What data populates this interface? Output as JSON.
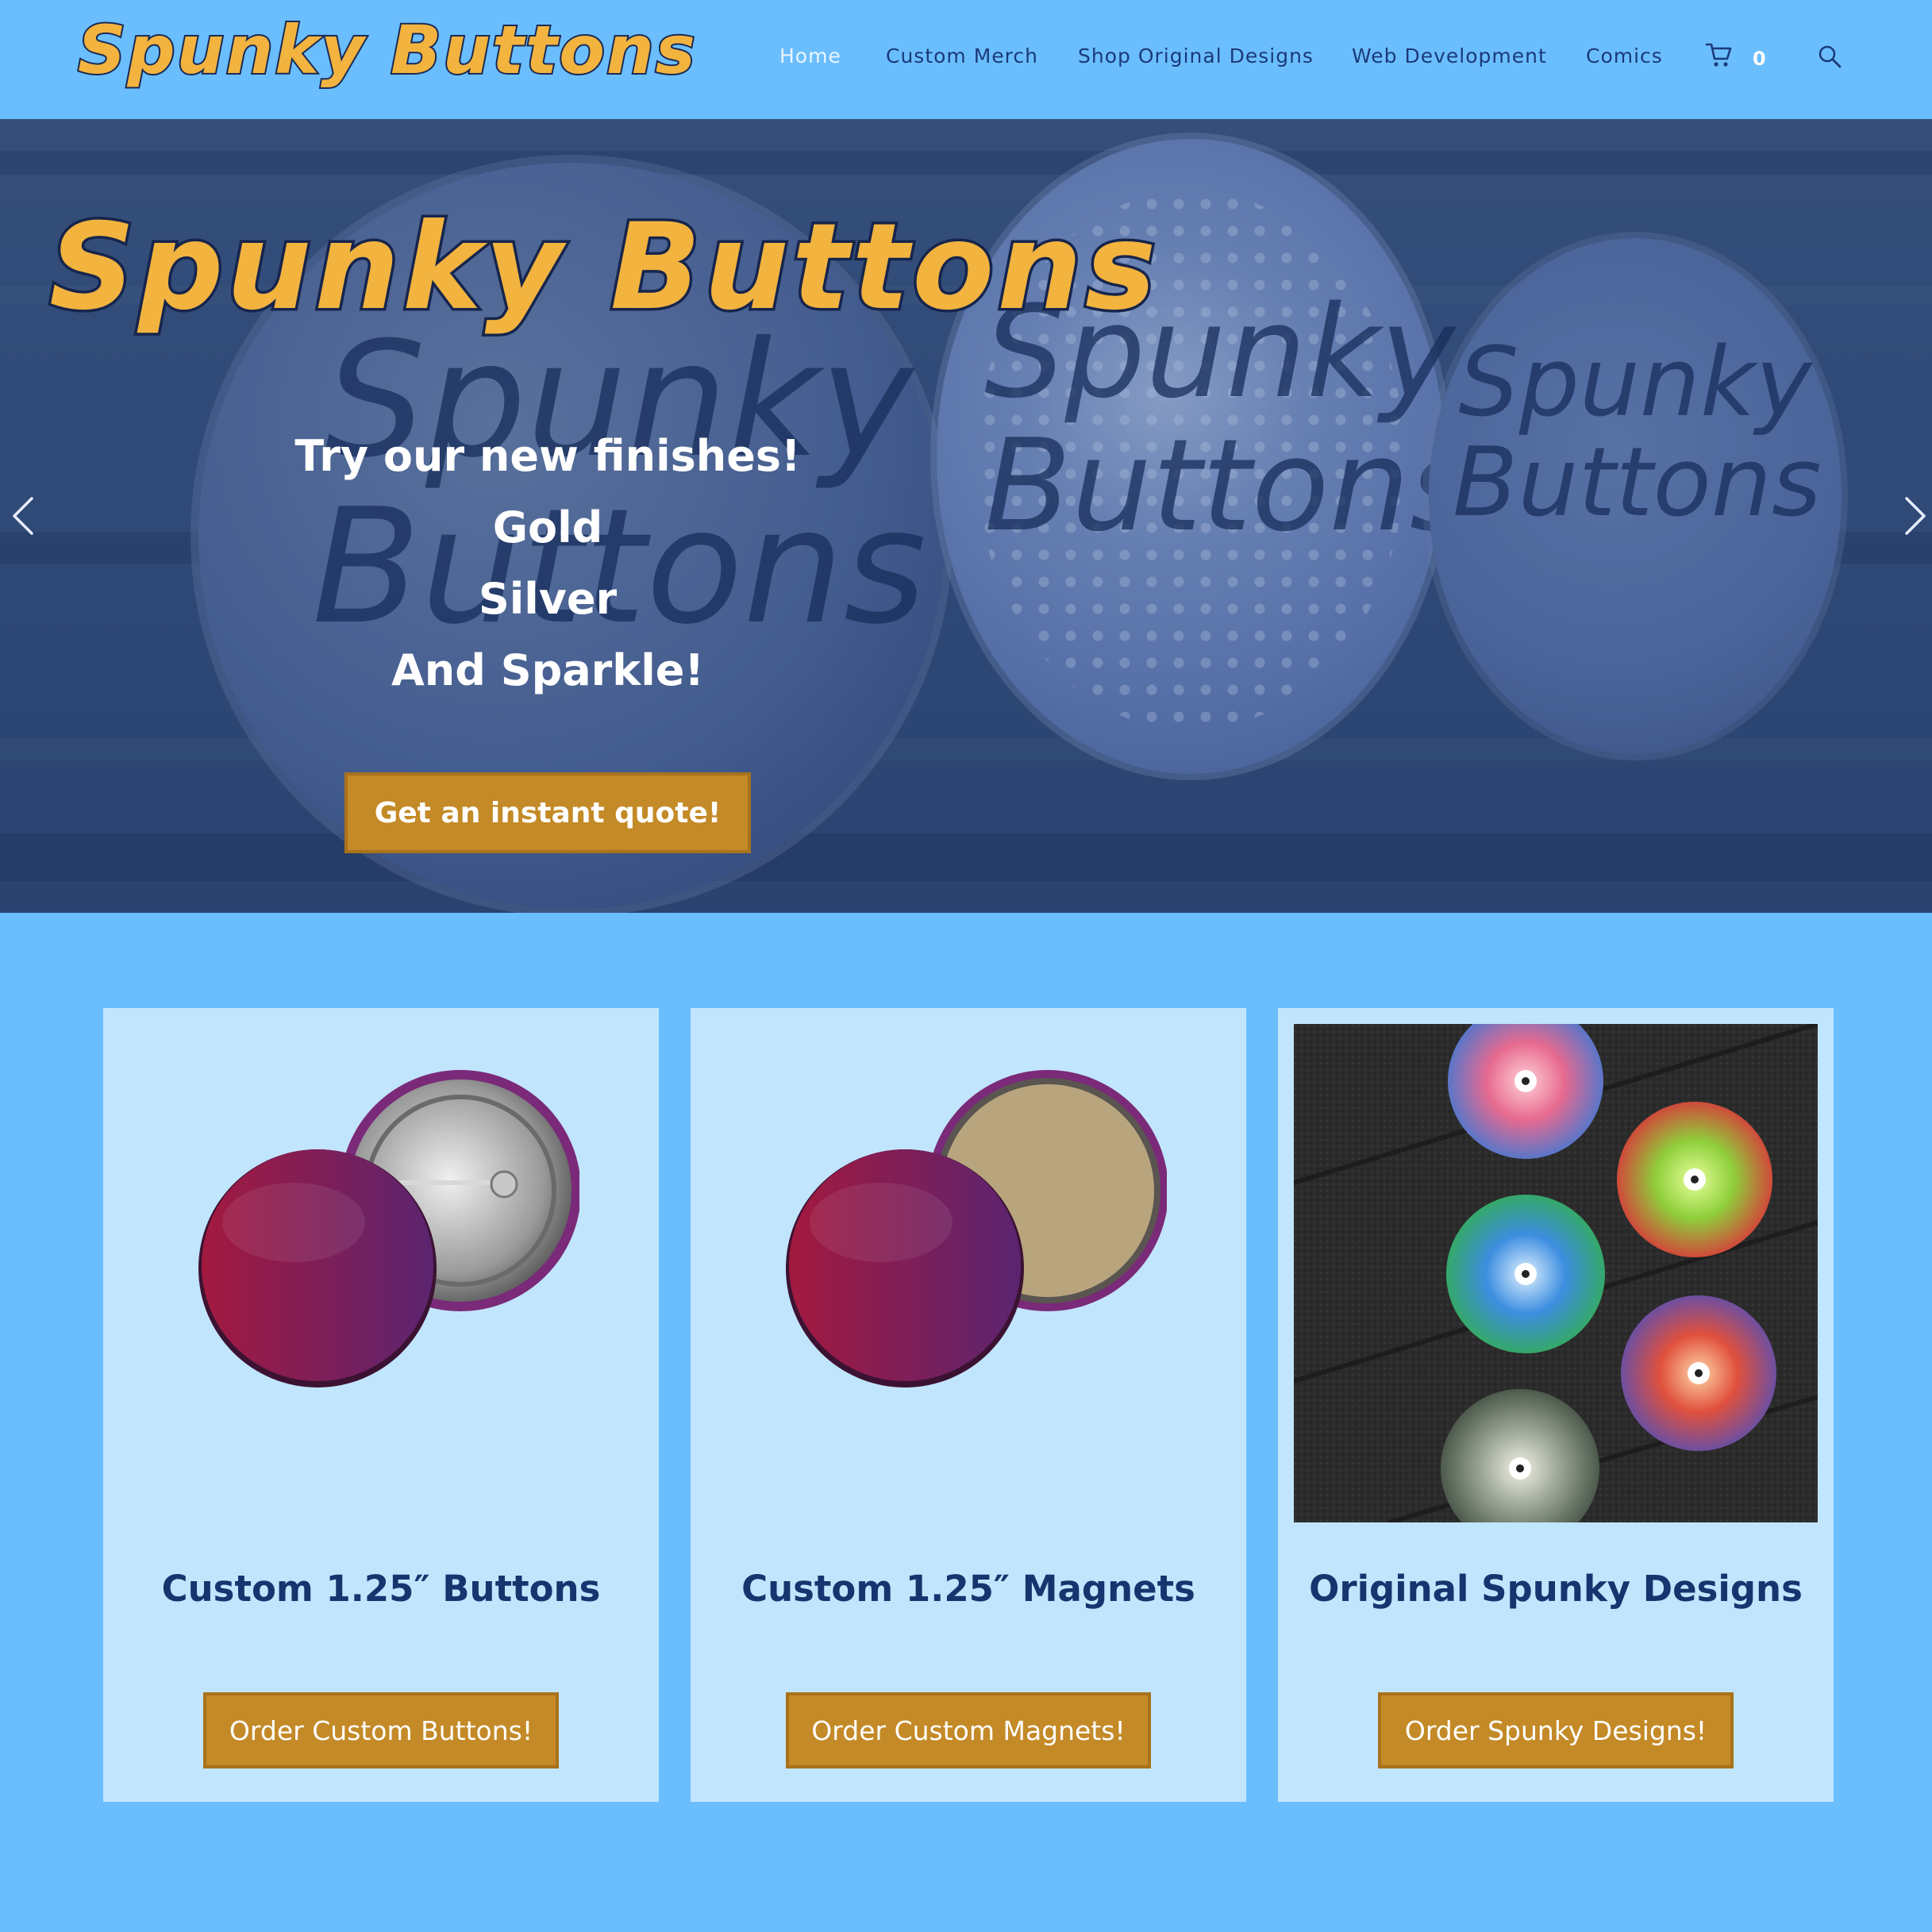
{
  "header": {
    "logo_text": "Spunky Buttons",
    "nav": [
      {
        "label": "Home"
      },
      {
        "label": "Custom Merch"
      },
      {
        "label": "Shop Original Designs"
      },
      {
        "label": "Web Development"
      },
      {
        "label": "Comics"
      }
    ],
    "active_nav": "Home",
    "cart_count": "0",
    "icons": {
      "cart": "shopping-cart-icon",
      "search": "search-icon"
    }
  },
  "hero": {
    "logo_text": "Spunky Buttons",
    "background_button_text": [
      "Spunky",
      "Buttons"
    ],
    "lines": [
      "Try our new finishes!",
      "Gold",
      "Silver",
      "And Sparkle!"
    ],
    "cta_label": "Get an instant quote!",
    "icons": {
      "prev": "chevron-left-icon",
      "next": "chevron-right-icon"
    }
  },
  "cards": [
    {
      "title": "Custom 1.25″ Buttons",
      "button_label": "Order Custom Buttons!",
      "image": "pin-button-photo"
    },
    {
      "title": "Custom 1.25″ Magnets",
      "button_label": "Order Custom Magnets!",
      "image": "magnet-button-photo"
    },
    {
      "title": "Original Spunky Designs",
      "button_label": "Order Spunky Designs!",
      "image": "eye-design-buttons-photo"
    }
  ],
  "colors": {
    "page_bg": "#6bbefd",
    "card_bg": "#c2e5fe",
    "accent": "#c48a27",
    "logo": "#f2b33f",
    "nav_text": "#1b3a7a",
    "title_text": "#17346f"
  }
}
